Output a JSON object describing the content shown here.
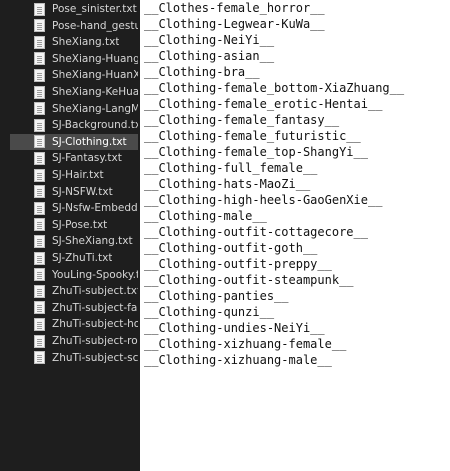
{
  "sidebar": {
    "files": [
      {
        "name": "Pose_sinister.txt",
        "selected": false
      },
      {
        "name": "Pose-hand_gestures",
        "selected": false
      },
      {
        "name": "SheXiang.txt",
        "selected": false
      },
      {
        "name": "SheXiang-HuangJin",
        "selected": false
      },
      {
        "name": "SheXiang-HuanXian",
        "selected": false
      },
      {
        "name": "SheXiang-KeHuang.",
        "selected": false
      },
      {
        "name": "SheXiang-LangMan",
        "selected": false
      },
      {
        "name": "SJ-Background.txt",
        "selected": false
      },
      {
        "name": "SJ-Clothing.txt",
        "selected": true
      },
      {
        "name": "SJ-Fantasy.txt",
        "selected": false
      },
      {
        "name": "SJ-Hair.txt",
        "selected": false
      },
      {
        "name": "SJ-NSFW.txt",
        "selected": false
      },
      {
        "name": "SJ-Nsfw-Embedding",
        "selected": false
      },
      {
        "name": "SJ-Pose.txt",
        "selected": false
      },
      {
        "name": "SJ-SheXiang.txt",
        "selected": false
      },
      {
        "name": "SJ-ZhuTi.txt",
        "selected": false
      },
      {
        "name": "YouLing-Spooky.txt",
        "selected": false
      },
      {
        "name": "ZhuTi-subject.txt",
        "selected": false
      },
      {
        "name": "ZhuTi-subject-fantas",
        "selected": false
      },
      {
        "name": "ZhuTi-subject-horro",
        "selected": false
      },
      {
        "name": "ZhuTi-subject-romar",
        "selected": false
      },
      {
        "name": "ZhuTi-subject-scifi.tx",
        "selected": false
      }
    ]
  },
  "editor": {
    "lines": [
      "__Clothes-female_horror__",
      "__Clothing-Legwear-KuWa__",
      "__Clothing-NeiYi__",
      "__Clothing-asian__",
      "__Clothing-bra__",
      "__Clothing-female_bottom-XiaZhuang__",
      "__Clothing-female_erotic-Hentai__",
      "__Clothing-female_fantasy__",
      "__Clothing-female_futuristic__",
      "__Clothing-female_top-ShangYi__",
      "__Clothing-full_female__",
      "__Clothing-hats-MaoZi__",
      "__Clothing-high-heels-GaoGenXie__",
      "__Clothing-male__",
      "__Clothing-outfit-cottagecore__",
      "__Clothing-outfit-goth__",
      "__Clothing-outfit-preppy__",
      "__Clothing-outfit-steampunk__",
      "__Clothing-panties__",
      "__Clothing-qunzi__",
      "__Clothing-undies-NeiYi__",
      "__Clothing-xizhuang-female__",
      "__Clothing-xizhuang-male__"
    ]
  }
}
